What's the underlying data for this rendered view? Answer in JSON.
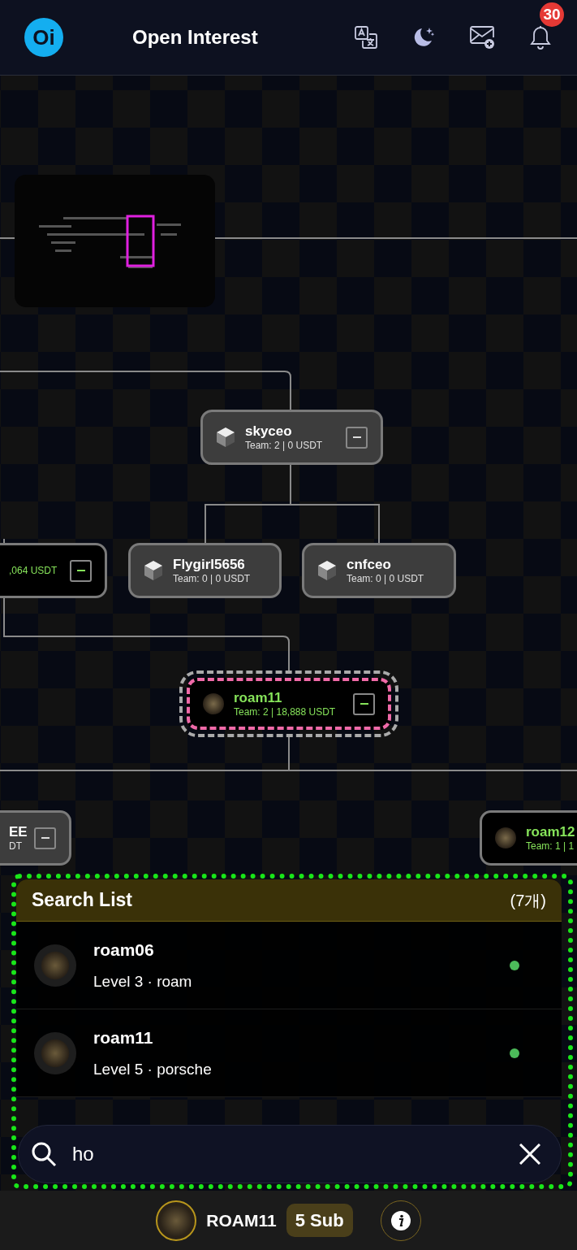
{
  "header": {
    "logo": "Oi",
    "title": "Open Interest",
    "notification_count": "30"
  },
  "tree": {
    "nodes": [
      {
        "name": "skyceo",
        "team": "Team: 2 | 0 USDT",
        "kind": "member",
        "highlighted": false,
        "collapsible": true
      },
      {
        "team": ",064 USDT",
        "kind": "active",
        "highlighted": false,
        "collapsible": true
      },
      {
        "name": "Flygirl5656",
        "team": "Team: 0 | 0 USDT",
        "kind": "member",
        "highlighted": false,
        "collapsible": false
      },
      {
        "name": "cnfceo",
        "team": "Team: 0 | 0 USDT",
        "kind": "member",
        "highlighted": false,
        "collapsible": false
      },
      {
        "name": "roam11",
        "team": "Team: 2 | 18,888 USDT",
        "kind": "active",
        "highlighted": true,
        "collapsible": true
      },
      {
        "name": "EE",
        "team": "DT",
        "kind": "member",
        "highlighted": false,
        "collapsible": true
      },
      {
        "name": "roam12",
        "team": "Team: 1 | 1",
        "kind": "active",
        "highlighted": false,
        "collapsible": false
      }
    ]
  },
  "search_list": {
    "title": "Search List",
    "count": "(7개)",
    "items": [
      {
        "name": "roam06",
        "detail": "Level 3 · roam",
        "online": true
      },
      {
        "name": "roam11",
        "detail": "Level 5 · porsche",
        "online": true
      }
    ]
  },
  "search": {
    "value": "ho"
  },
  "footer": {
    "user": "ROAM11",
    "sub_badge": "5 Sub"
  }
}
